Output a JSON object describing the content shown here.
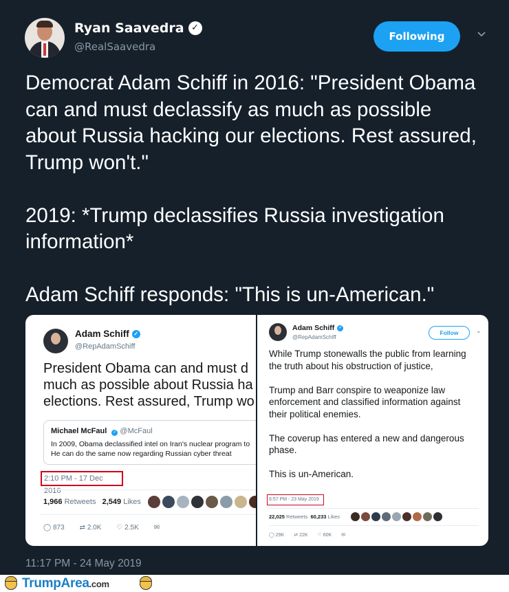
{
  "tweet": {
    "author": {
      "name": "Ryan Saavedra",
      "handle": "@RealSaavedra"
    },
    "follow_label": "Following",
    "body": [
      "Democrat Adam Schiff in 2016: \"President Obama can and must declassify as much as possible about Russia hacking our elections. Rest assured, Trump won't.\"",
      "2019: *Trump declassifies Russia investigation information*",
      "Adam Schiff responds: \"This is un-American.\""
    ],
    "timestamp": "11:17 PM - 24 May 2019"
  },
  "embed_left": {
    "name": "Adam Schiff",
    "handle": "@RepAdamSchiff",
    "text_lines": [
      "President Obama can and must d",
      "much as possible about Russia ha",
      "elections. Rest assured, Trump wo"
    ],
    "quote": {
      "name": "Michael McFaul",
      "handle": "@McFaul",
      "lines": [
        "In 2009, Obama declassified intel on Iran's nuclear program  to",
        "He can do the same now regarding Russian cyber threat"
      ]
    },
    "time": "2:10 PM - 17 Dec 2016",
    "retweets": "1,966",
    "retweets_label": "Retweets",
    "likes": "2,549",
    "likes_label": "Likes",
    "replies_count": "873",
    "rt_count": "2.0K",
    "like_count": "2.5K"
  },
  "embed_right": {
    "name": "Adam Schiff",
    "handle": "@RepAdamSchiff",
    "follow_label": "Follow",
    "paragraphs": [
      "While Trump stonewalls the public from learning the truth about his obstruction of justice,",
      "Trump and Barr conspire to weaponize law enforcement and classified information against their political enemies.",
      "The coverup has entered a new and dangerous phase.",
      "This is un-American."
    ],
    "time": "6:57 PM - 23 May 2019",
    "retweets": "22,025",
    "retweets_label": "Retweets",
    "likes": "60,233",
    "likes_label": "Likes",
    "replies_count": "29K",
    "rt_count": "22K",
    "like_count": "60K"
  },
  "footer": {
    "site": "TrumpArea",
    "tld": ".com"
  },
  "colors": {
    "background": "#15202b",
    "accent": "#1da1f2",
    "muted": "#8899a6",
    "highlight": "#d0021b"
  }
}
